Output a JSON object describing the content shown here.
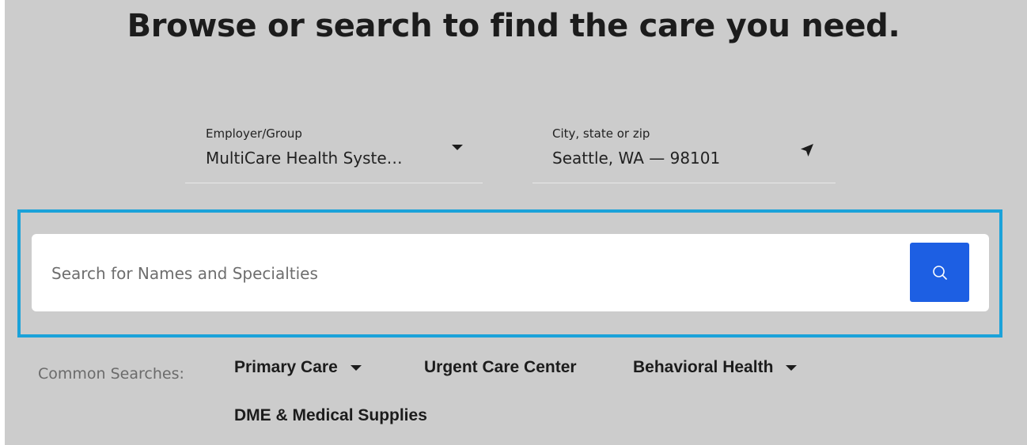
{
  "page": {
    "title": "Browse or search to find the care you need."
  },
  "filters": {
    "employer": {
      "label": "Employer/Group",
      "value": "MultiCare Health Syste…"
    },
    "location": {
      "label": "City, state or zip",
      "value": "Seattle, WA — 98101"
    }
  },
  "search": {
    "placeholder": "Search for Names and Specialties",
    "button_icon": "search-icon"
  },
  "common_searches": {
    "label": "Common Searches:",
    "items": [
      {
        "label": "Primary Care",
        "has_dropdown": true
      },
      {
        "label": "Urgent Care Center",
        "has_dropdown": false
      },
      {
        "label": "Behavioral Health",
        "has_dropdown": true
      },
      {
        "label": "DME & Medical Supplies",
        "has_dropdown": false
      }
    ]
  },
  "colors": {
    "background": "#cccccc",
    "highlight": "#1ba2d9",
    "search_button": "#1d5fe3"
  }
}
